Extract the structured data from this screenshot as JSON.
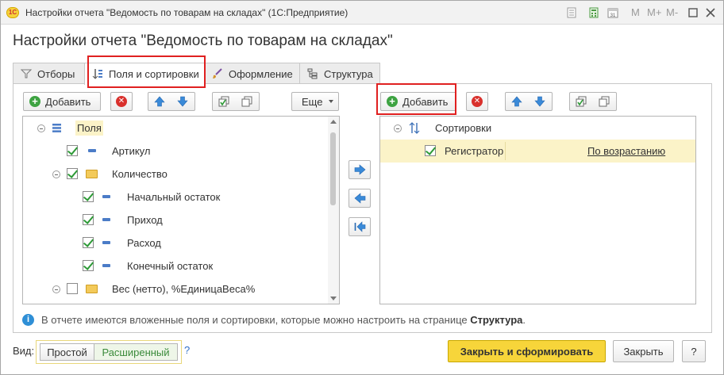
{
  "window": {
    "title": "Настройки отчета \"Ведомость по товарам на складах\" (1С:Предприятие)",
    "toolbar_items": [
      "M",
      "M+",
      "M-"
    ],
    "logo_text": "1С"
  },
  "page_title": "Настройки отчета \"Ведомость по товарам на складах\"",
  "tabs": [
    {
      "label": "Отборы"
    },
    {
      "label": "Поля и сортировки"
    },
    {
      "label": "Оформление"
    },
    {
      "label": "Структура"
    }
  ],
  "left_toolbar": {
    "add_label": "Добавить",
    "more_label": "Еще"
  },
  "right_toolbar": {
    "add_label": "Добавить"
  },
  "fields_tree": [
    {
      "label": "Поля"
    },
    {
      "label": "Артикул"
    },
    {
      "label": "Количество"
    },
    {
      "label": "Начальный остаток"
    },
    {
      "label": "Приход"
    },
    {
      "label": "Расход"
    },
    {
      "label": "Конечный остаток"
    },
    {
      "label": "Вес (нетто), %ЕдиницаВеса%"
    }
  ],
  "sort_tree": {
    "root_label": "Сортировки",
    "items": [
      {
        "field": "Регистратор",
        "direction": "По возрастанию"
      }
    ]
  },
  "info": {
    "text": "В отчете имеются вложенные поля и сортировки, которые можно настроить на странице ",
    "link": "Структура",
    "suffix": "."
  },
  "view": {
    "label": "Вид:",
    "options": [
      "Простой",
      "Расширенный"
    ],
    "help": "?"
  },
  "actions": {
    "run_label": "Закрыть и сформировать",
    "close_label": "Закрыть",
    "help_label": "?"
  },
  "colors": {
    "accent_yellow": "#f7d53a",
    "highlight_row": "#fbf3c8",
    "check_green": "#2e9a37"
  }
}
